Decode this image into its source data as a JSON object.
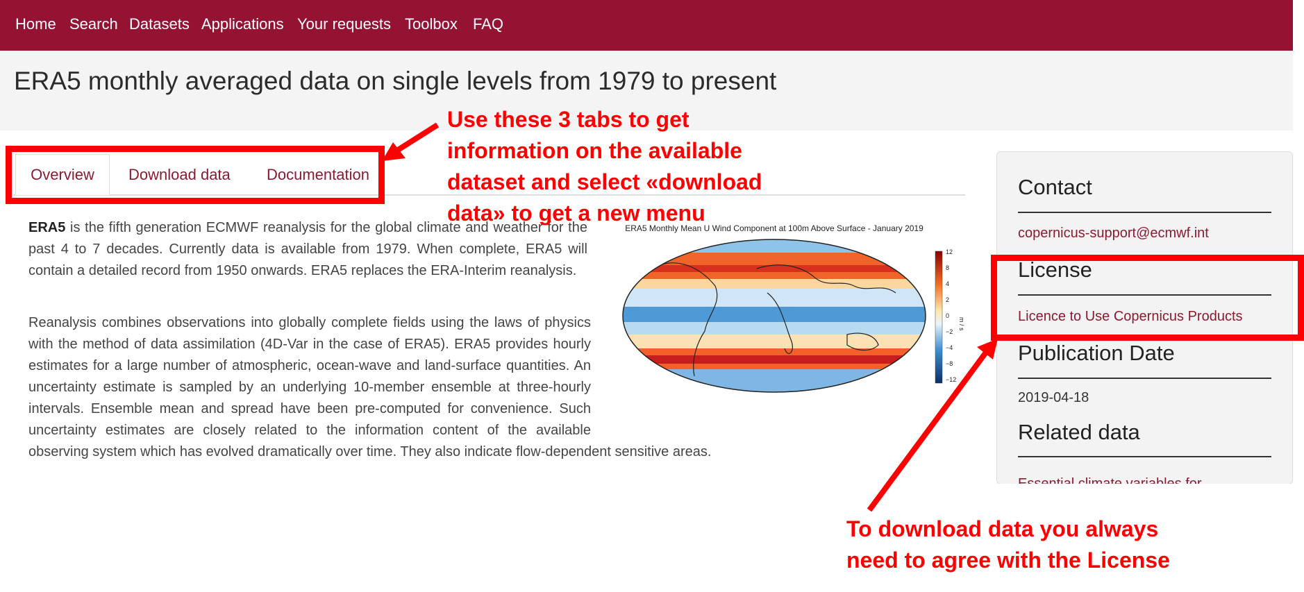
{
  "nav": {
    "items": [
      "Home",
      "Search",
      "Datasets",
      "Applications",
      "Your requests",
      "Toolbox",
      "FAQ"
    ]
  },
  "page": {
    "title": "ERA5 monthly averaged data on single levels from 1979 to present"
  },
  "tabs": [
    {
      "label": "Overview",
      "active": true
    },
    {
      "label": "Download data",
      "active": false
    },
    {
      "label": "Documentation",
      "active": false
    }
  ],
  "overview": {
    "p1_lead": "ERA5",
    "p1_rest": " is the fifth generation ECMWF reanalysis for the global climate and weather for the past 4 to 7 decades. Currently data is available from 1979. When complete, ERA5 will contain a detailed record from 1950 onwards. ERA5 replaces the ERA-Interim reanalysis.",
    "p2": "Reanalysis combines observations into globally complete fields using the laws of physics with the method of data assimilation (4D-Var in the case of ERA5). ERA5 provides hourly estimates for a large number of atmospheric, ocean-wave and land-surface quantities. An uncertainty estimate is sampled by an underlying 10-member ensemble at three-hourly intervals. Ensemble mean and spread have been pre-computed for convenience. Such uncertainty estimates are closely related to the information content of the available observing system which has evolved dramatically over time. They also indicate flow-dependent sensitive areas."
  },
  "figure": {
    "title": "ERA5 Monthly Mean U Wind Component at 100m Above Surface - January 2019",
    "colorbar_ticks": [
      "12",
      "8",
      "4",
      "2",
      "0",
      "−2",
      "−4",
      "−8",
      "−12"
    ],
    "colorbar_unit": "m / s"
  },
  "sidebar": {
    "contact_heading": "Contact",
    "contact_email": "copernicus-support@ecmwf.int",
    "license_heading": "License",
    "license_link": "Licence to Use Copernicus Products",
    "pubdate_heading": "Publication Date",
    "pubdate": "2019-04-18",
    "related_heading": "Related data",
    "related_link": "Essential climate variables for"
  },
  "annotations": {
    "tabs_note": [
      "Use these 3 tabs to get",
      "information on the available",
      "dataset and select «download",
      "data» to get a new menu"
    ],
    "license_note": [
      "To download data you always",
      "need to agree with the License"
    ]
  },
  "colors": {
    "brand": "#941333",
    "link": "#8b1a2f",
    "annotation": "#ff0000"
  }
}
